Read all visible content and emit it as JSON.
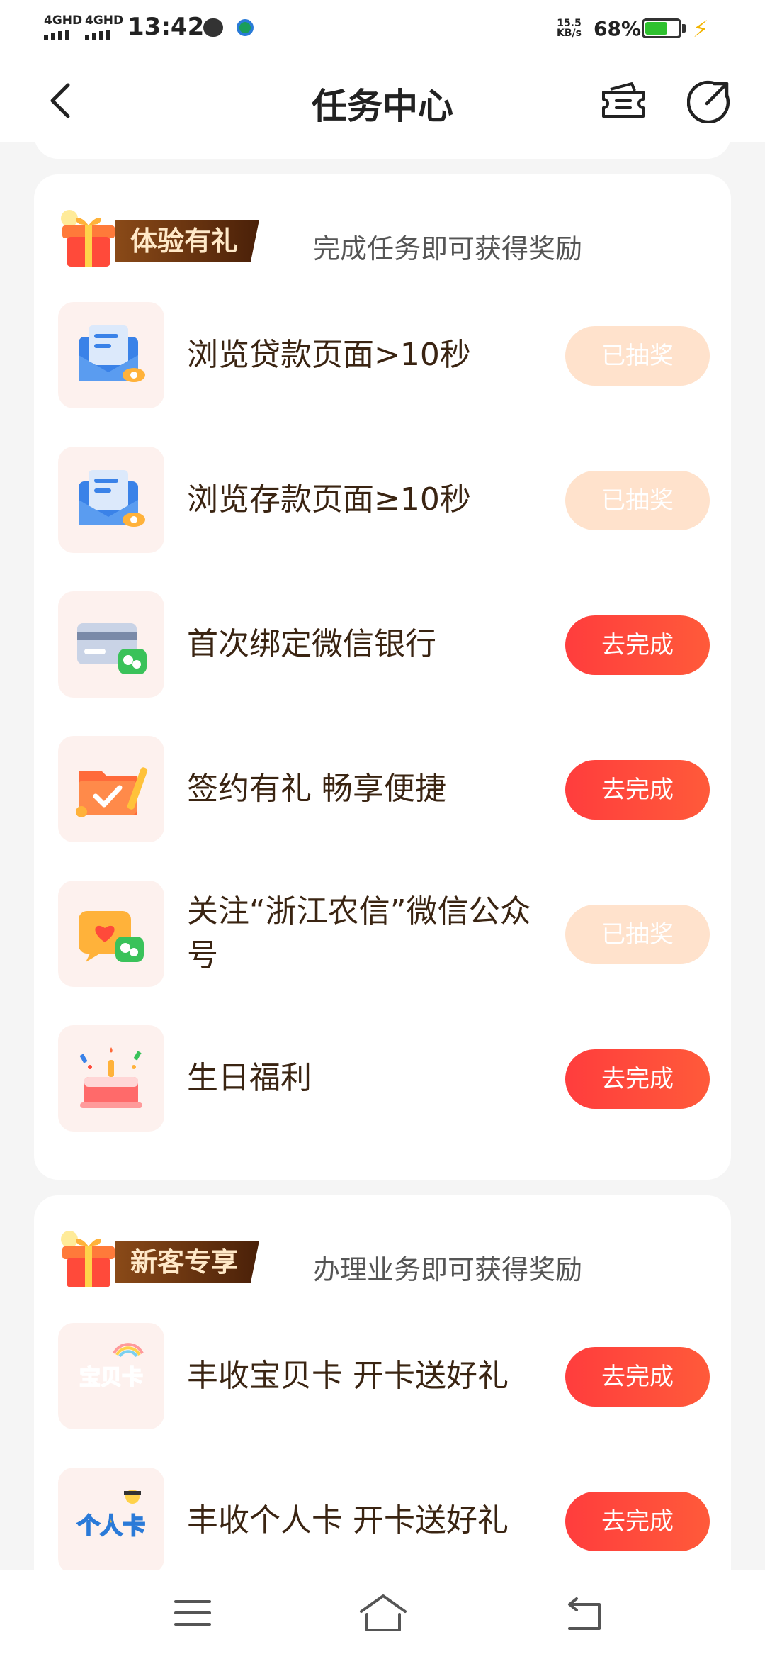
{
  "status_bar": {
    "signal1": "4GHD",
    "signal2": "4GHD",
    "time": "13:42",
    "speed_value": "15.5",
    "speed_unit": "KB/s",
    "battery_percent": "68%",
    "battery_level": 0.68,
    "battery_color": "#2ec12e"
  },
  "header": {
    "title": "任务中心",
    "back_icon": "chevron-left-icon",
    "ticket_icon": "ticket-icon",
    "share_icon": "share-icon"
  },
  "sections": [
    {
      "tag": "体验有礼",
      "description": "完成任务即可获得奖励",
      "tasks": [
        {
          "icon": "mail-eye-icon",
          "label": "浏览贷款页面>10秒",
          "button": "已抽奖",
          "state": "done"
        },
        {
          "icon": "mail-eye-icon",
          "label": "浏览存款页面≥10秒",
          "button": "已抽奖",
          "state": "done"
        },
        {
          "icon": "bank-card-wechat-icon",
          "label": "首次绑定微信银行",
          "button": "去完成",
          "state": "todo"
        },
        {
          "icon": "folder-check-icon",
          "label": "签约有礼 畅享便捷",
          "button": "去完成",
          "state": "todo"
        },
        {
          "icon": "heart-chat-wechat-icon",
          "label": "关注“浙江农信”微信公众号",
          "button": "已抽奖",
          "state": "done"
        },
        {
          "icon": "birthday-cake-icon",
          "label": "生日福利",
          "button": "去完成",
          "state": "todo"
        }
      ]
    },
    {
      "tag": "新客专享",
      "description": "办理业务即可获得奖励",
      "tasks": [
        {
          "icon": "baobei-card-icon",
          "icon_text": "宝贝卡",
          "label": "丰收宝贝卡 开卡送好礼",
          "button": "去完成",
          "state": "todo"
        },
        {
          "icon": "personal-card-icon",
          "icon_text": "个人卡",
          "label": "丰收个人卡 开卡送好礼",
          "button": "去完成",
          "state": "todo"
        }
      ]
    }
  ],
  "bottom_nav": {
    "menu_icon": "menu-icon",
    "home_icon": "home-icon",
    "back_icon": "back-icon"
  },
  "colors": {
    "accent_button": "#ff3d3d",
    "done_button": "#ffe2cc",
    "tag_background": "#6a3410"
  }
}
